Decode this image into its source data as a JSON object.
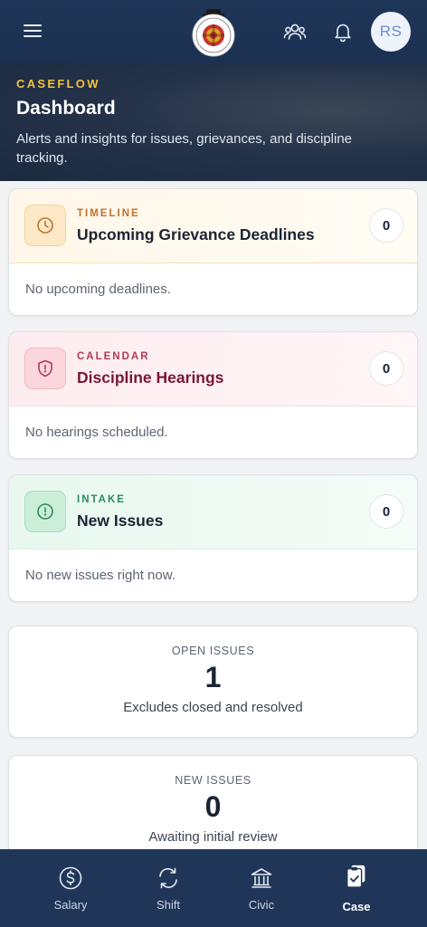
{
  "header": {
    "menu_icon": "hamburger-menu-icon",
    "logo_icon": "union-seal-logo",
    "members_icon": "group-icon",
    "notifications_icon": "bell-icon",
    "avatar_initials": "RS"
  },
  "hero": {
    "kicker": "CASEFLOW",
    "title": "Dashboard",
    "subtitle": "Alerts and insights for issues, grievances, and discipline tracking."
  },
  "alerts": [
    {
      "icon": "clock-icon",
      "kicker": "TIMELINE",
      "title": "Upcoming Grievance Deadlines",
      "count": "0",
      "empty_text": "No upcoming deadlines.",
      "accent": "#c0722d"
    },
    {
      "icon": "shield-alert-icon",
      "kicker": "CALENDAR",
      "title": "Discipline Hearings",
      "count": "0",
      "empty_text": "No hearings scheduled.",
      "accent": "#b03a55"
    },
    {
      "icon": "alert-circle-icon",
      "kicker": "INTAKE",
      "title": "New Issues",
      "count": "0",
      "empty_text": "No new issues right now.",
      "accent": "#2e8a5d"
    }
  ],
  "stats": [
    {
      "label": "OPEN ISSUES",
      "value": "1",
      "sub": "Excludes closed and resolved"
    },
    {
      "label": "NEW ISSUES",
      "value": "0",
      "sub": "Awaiting initial review"
    }
  ],
  "bottom_nav": [
    {
      "label": "Salary",
      "icon": "dollar-circle-icon",
      "active": false
    },
    {
      "label": "Shift",
      "icon": "repeat-icon",
      "active": false
    },
    {
      "label": "Civic",
      "icon": "landmark-icon",
      "active": false
    },
    {
      "label": "Case",
      "icon": "clipboard-check-icon",
      "active": true
    }
  ],
  "colors": {
    "navbar": "#1f3658",
    "kicker_gold": "#f2c23a",
    "avatar_text": "#6b8fd1"
  }
}
